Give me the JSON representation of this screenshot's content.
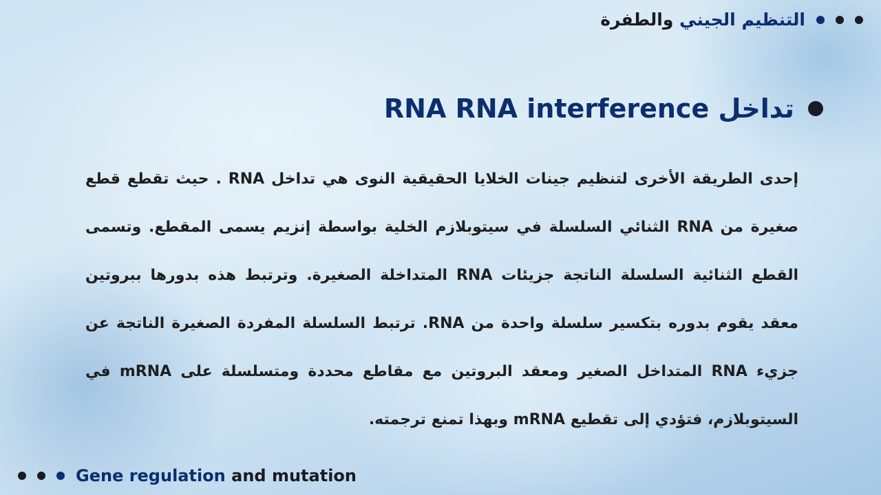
{
  "header": {
    "title_part1": "التنظيم الجيني",
    "title_part2": "والطفرة"
  },
  "section": {
    "heading": "تداخل RNA   RNA interference"
  },
  "paragraph": "إحدى الطريقة الأخرى لتنظيم جينات الخلايا الحقيقية النوى هي تداخل RNA . حيث تقطع قطع صغيرة من RNA الثنائي السلسلة في سيتوبلازم الخلية بواسطة إنزيم يسمى المقطع. وتسمى القطع الثنائية السلسلة الناتجة جزيئات RNA المتداخلة الصغيرة. وترتبط هذه بدورها ببروتين معقد يقوم بدوره بتكسير سلسلة واحدة من RNA. ترتبط السلسلة المفردة الصغيرة الناتجة عن جزيء RNA المتداخل الصغير ومعقد البروتين مع مقاطع محددة ومتسلسلة على mRNA في السيتوبلازم، فتؤدي إلى تقطيع mRNA وبهذا تمنع ترجمته.",
  "footer": {
    "title_part1": "Gene regulation",
    "title_part2": "and mutation"
  },
  "colors": {
    "accent": "#0b2e6e",
    "dark": "#1a1a22",
    "background": "#a9cbe6"
  }
}
